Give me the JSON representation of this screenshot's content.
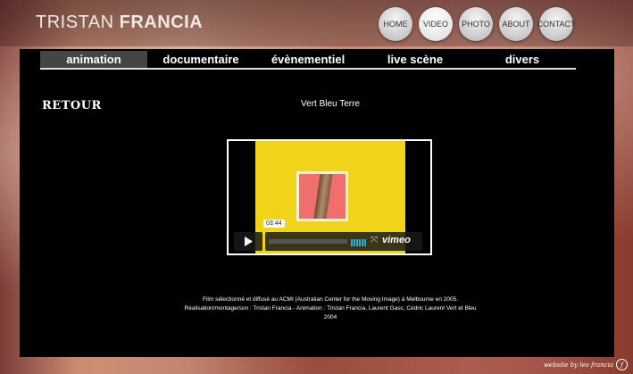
{
  "site": {
    "title_light": "TRISTAN ",
    "title_bold": "FRANCIA"
  },
  "nav": [
    {
      "label": "HOME"
    },
    {
      "label": "VIDEO"
    },
    {
      "label": "PHOTO"
    },
    {
      "label": "ABOUT"
    },
    {
      "label": "CONTACT"
    }
  ],
  "categories": [
    {
      "label": "animation"
    },
    {
      "label": "documentaire"
    },
    {
      "label": "évènementiel"
    },
    {
      "label": "live scène"
    },
    {
      "label": "divers"
    }
  ],
  "content": {
    "back_label": "RETOUR",
    "video_title": "Vert Bleu Terre",
    "description_line1": "Film sélectionné et diffusé au ACMI (Australian Center for the Moving Image) à Melbourne en 2005.",
    "description_line2": "Réalisation/montage/son : Tristan Francia - Animation : Tristan Francia, Laurent Gasc, Cédric Laurent Vert et Bleu",
    "description_line3": "2004"
  },
  "player": {
    "duration": "03:44",
    "brand": "vimeo",
    "accent_color": "#23b0d6",
    "play_icon": "play-icon",
    "fullscreen_icon": "fullscreen-icon"
  },
  "footer": {
    "credit": "website by leo francia"
  }
}
